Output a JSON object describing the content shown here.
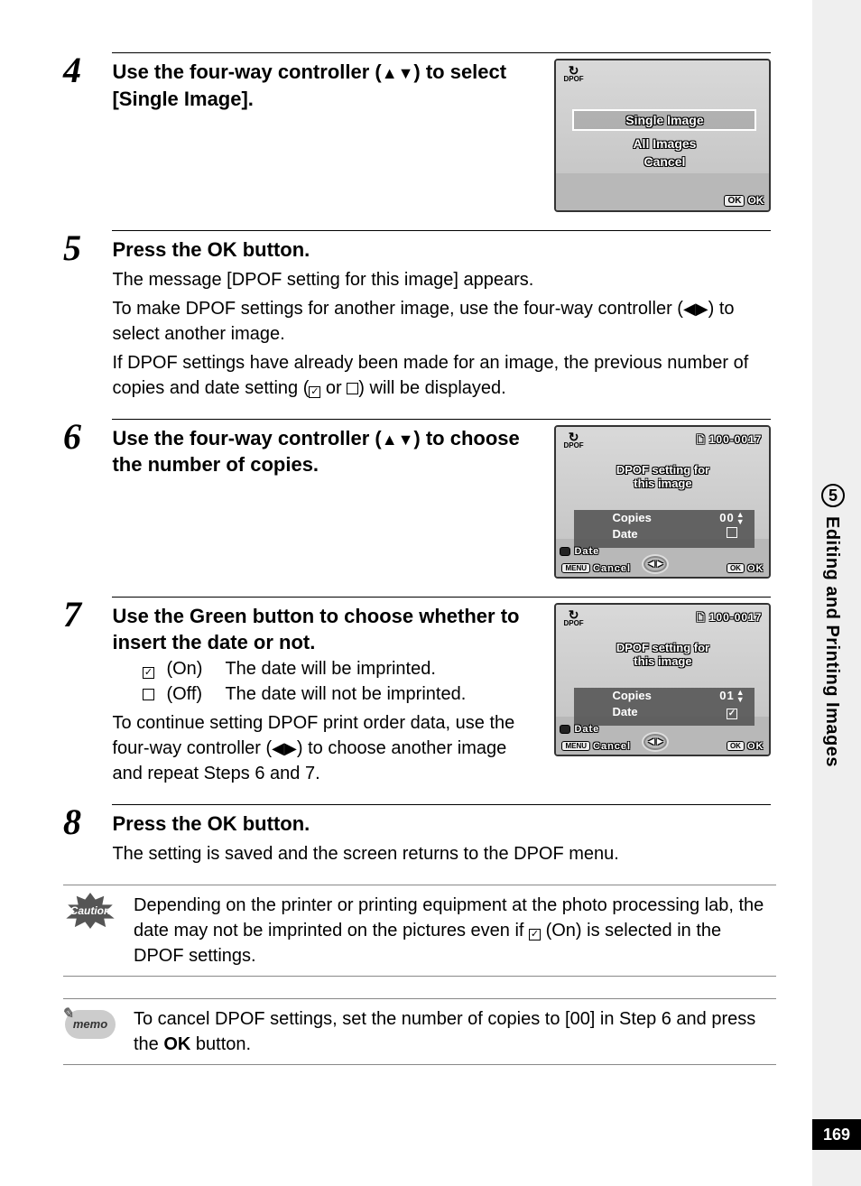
{
  "sidebar": {
    "chapter": "5",
    "title": "Editing and Printing Images",
    "page": "169"
  },
  "steps": {
    "s4": {
      "num": "4",
      "heading_a": "Use the four-way controller (",
      "heading_b": ") to select [Single Image].",
      "screen": {
        "menu": {
          "single": "Single Image",
          "all": "All Images",
          "cancel": "Cancel"
        },
        "ok_box": "OK",
        "ok_word": "OK",
        "dpof": "DPOF"
      }
    },
    "s5": {
      "num": "5",
      "heading_a": "Press the ",
      "heading_ok": "OK",
      "heading_b": " button.",
      "line1": "The message [DPOF setting for this image] appears.",
      "line2a": "To make DPOF settings for another image, use the four-way controller (",
      "line2b": ") to select another image.",
      "line3a": "If DPOF settings have already been made for an image, the previous number of copies and date setting (",
      "line3b": " or ",
      "line3c": ") will be displayed."
    },
    "s6": {
      "num": "6",
      "heading_a": "Use the four-way controller (",
      "heading_b": ") to choose the number of copies.",
      "screen": {
        "folder": "100-0017",
        "title_l1": "DPOF setting for",
        "title_l2": "this image",
        "copies_label": "Copies",
        "copies_value": "00",
        "date_label_row": "Date",
        "green_label": "Date",
        "menu_box": "MENU",
        "cancel": "Cancel",
        "ok_box": "OK",
        "ok_word": "OK",
        "dpof": "DPOF"
      }
    },
    "s7": {
      "num": "7",
      "heading": "Use the Green button to choose whether to insert the date or not.",
      "on_check": "O",
      "on_state": "(On)",
      "on_desc": "The date will be imprinted.",
      "off_check": "P",
      "off_state": "(Off)",
      "off_desc": "The date will not be imprinted.",
      "cont_a": "To continue setting DPOF print order data, use the four-way controller (",
      "cont_b": ") to choose another image and repeat Steps 6 and 7.",
      "screen": {
        "folder": "100-0017",
        "title_l1": "DPOF setting for",
        "title_l2": "this image",
        "copies_label": "Copies",
        "copies_value": "01",
        "date_label_row": "Date",
        "green_label": "Date",
        "menu_box": "MENU",
        "cancel": "Cancel",
        "ok_box": "OK",
        "ok_word": "OK",
        "dpof": "DPOF"
      }
    },
    "s8": {
      "num": "8",
      "heading_a": "Press the ",
      "heading_ok": "OK",
      "heading_b": " button.",
      "line1": "The setting is saved and the screen returns to the DPOF menu."
    }
  },
  "caution": {
    "label": "Caution",
    "text_a": "Depending on the printer or printing equipment at the photo processing lab, the date may not be imprinted on the pictures even if ",
    "text_b": " (On) is selected in the DPOF settings."
  },
  "memo": {
    "label": "memo",
    "text_a": "To cancel DPOF settings, set the number of copies to [00] in Step 6 and press the ",
    "text_ok": "OK",
    "text_b": " button."
  }
}
